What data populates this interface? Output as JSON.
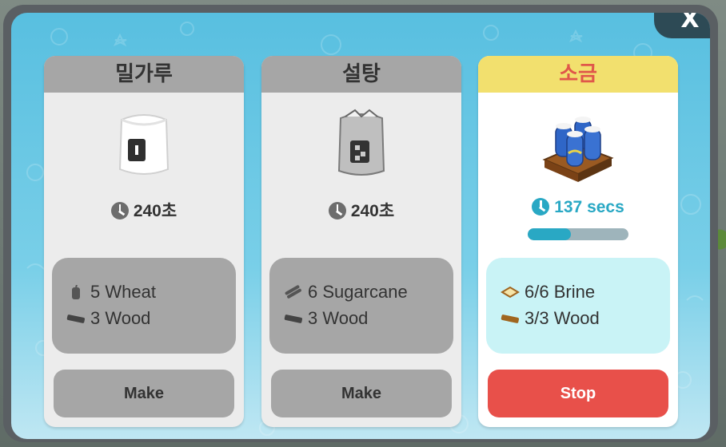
{
  "close_label": "X",
  "colors": {
    "accent": "#29a8c4",
    "stop": "#e8504a",
    "active_header": "#f2e06e",
    "active_title": "#e0574a",
    "inactive": "#a6a6a6"
  },
  "recipes": [
    {
      "title": "밀가루",
      "product_icon": "flour-bag-icon",
      "time": "240초",
      "ingredients": [
        {
          "icon": "wheat-icon",
          "text": "5 Wheat"
        },
        {
          "icon": "wood-log-icon",
          "text": "3 Wood"
        }
      ],
      "button_label": "Make"
    },
    {
      "title": "설탕",
      "product_icon": "sugar-bag-icon",
      "time": "240초",
      "ingredients": [
        {
          "icon": "sugarcane-icon",
          "text": "6 Sugarcane"
        },
        {
          "icon": "wood-log-icon",
          "text": "3 Wood"
        }
      ],
      "button_label": "Make"
    },
    {
      "title": "소금",
      "product_icon": "salt-crate-icon",
      "time": "137 secs",
      "progress": 0.43,
      "ingredients": [
        {
          "icon": "brine-icon",
          "text": "6/6 Brine"
        },
        {
          "icon": "wood-log-icon",
          "text": "3/3 Wood"
        }
      ],
      "button_label": "Stop"
    }
  ]
}
